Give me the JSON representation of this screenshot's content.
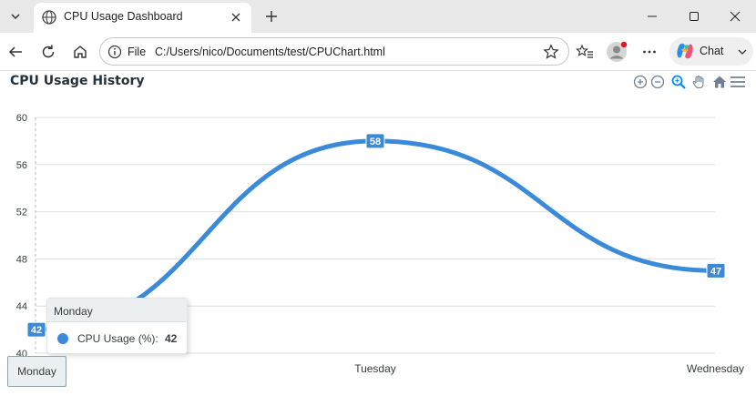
{
  "browser": {
    "tab_title": "CPU Usage Dashboard",
    "omnibox_scheme": "File",
    "url": "C:/Users/nico/Documents/test/CPUChart.html",
    "chat_label": "Chat"
  },
  "page": {
    "chart_title": "CPU Usage History",
    "tooltip": {
      "title": "Monday",
      "series_name": "CPU Usage (%):",
      "value": "42"
    },
    "xaxis_tooltip": "Monday"
  },
  "colors": {
    "series": "#3b8ad9",
    "grid": "#e0e0e0",
    "tool_active": "#008ffb",
    "tool_idle": "#6e8192"
  },
  "icons": [
    "tab-menu-icon",
    "globe-icon",
    "close-icon",
    "plus-icon",
    "minimize-icon",
    "maximize-icon",
    "back-arrow-icon",
    "reload-icon",
    "home-icon",
    "info-icon",
    "star-icon",
    "favorites-icon",
    "profile-avatar-icon",
    "more-icon",
    "copilot-icon",
    "chevron-down-icon",
    "zoom-in-icon",
    "zoom-out-icon",
    "selection-zoom-icon",
    "pan-hand-icon",
    "reset-home-icon",
    "menu-icon"
  ],
  "chart_data": {
    "type": "line",
    "title": "CPU Usage History",
    "categories": [
      "Monday",
      "Tuesday",
      "Wednesday"
    ],
    "series": [
      {
        "name": "CPU Usage (%)",
        "values": [
          42,
          58,
          47
        ]
      }
    ],
    "ylim": [
      40,
      60
    ],
    "yticks": [
      "40",
      "44",
      "48",
      "52",
      "56",
      "60"
    ],
    "data_labels": [
      "42",
      "58",
      "47"
    ],
    "curve": "smooth",
    "grid": true,
    "legend": "none"
  }
}
